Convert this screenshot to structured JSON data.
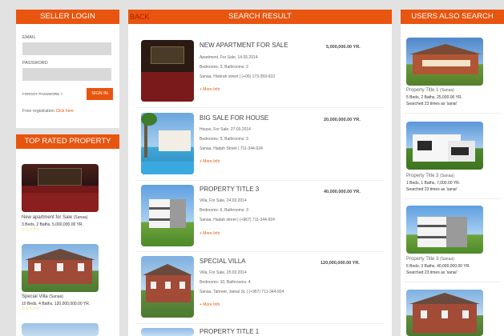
{
  "seller_login": {
    "header": "SELLER LOGIN",
    "email_label": "EMAIL",
    "password_label": "PASSWORD",
    "forgot_label": "FORGOT PASSWORD ?",
    "signin_label": "SIGN IN",
    "free_reg_text": "Free registration",
    "click_here": "Click here"
  },
  "top_rated": {
    "header": "TOP RATED PROPERTY",
    "items": [
      {
        "title": "New apartment for Sale",
        "city": "(Sanaa)",
        "meta": "3 Beds, 2 Baths, 5,000,000.00 YR.",
        "stars": "☆☆☆☆☆"
      },
      {
        "title": "Special Villa",
        "city": "(Sanaa)",
        "meta": "10 Beds, 4 Baths, 120,000,000.00 YR.",
        "stars": "☆☆☆☆☆"
      }
    ]
  },
  "search": {
    "back": "BACK",
    "header": "SEARCH RESULT",
    "more_info": "+ More Info",
    "results": [
      {
        "title": "NEW APARTMENT FOR SALE",
        "type_date": "Apartment, For Sale, 14.05.2014",
        "rooms": "Bedrooms: 3, Bathrooms: 2",
        "address": "Sanaa, Hisbrah street | (+00) 173-359-910",
        "price": "5,000,000.00 YR."
      },
      {
        "title": "BIG SALE FOR HOUSE",
        "type_date": "House, For Sale, 27.03.2014",
        "rooms": "Bedrooms: 5, Bathrooms: 3",
        "address": "Sanaa, Hadah Street | 711-344-924",
        "price": "20,000,000.00 YR."
      },
      {
        "title": "PROPERTY TITLE 3",
        "type_date": "Villa, For Sale, 24.03.2014",
        "rooms": "Bedrooms: 6, Bathrooms: 3",
        "address": "Sanaa, Hadah street | (+967) 711-344-924",
        "price": "40,000,000.00 YR."
      },
      {
        "title": "SPECIAL VILLA",
        "type_date": "Villa, For Sale, 25.03.2014",
        "rooms": "Bedrooms: 10, Bathrooms: 4",
        "address": "Sanaa, Tahreer, Jamal St. | (+967) 711-344-924",
        "price": "120,000,000.00 YR."
      },
      {
        "title": "PROPERTY TITLE 1",
        "type_date": "",
        "rooms": "",
        "address": "",
        "price": ""
      }
    ]
  },
  "users_also": {
    "header": "USERS ALSO SEARCH",
    "items": [
      {
        "title": "Property Title 1",
        "city": "(Sanaa)",
        "meta": "5 Beds, 2 Baths, 25,000.00 YR.",
        "searched": "Searched 23 times as 'sanai'"
      },
      {
        "title": "Property Title 3",
        "city": "(Sanaa)",
        "meta": "1 Beds, 1 Baths, 7,000.00 YR.",
        "searched": "Searched 23 times as 'sanai'"
      },
      {
        "title": "Property Title 3",
        "city": "(Sanaa)",
        "meta": "6 Beds, 3 Baths, 40,000,000.00 YR.",
        "searched": "Searched 23 times as 'sanai'"
      }
    ]
  },
  "colors": {
    "accent": "#e8550f",
    "background": "#e2e2e2"
  }
}
